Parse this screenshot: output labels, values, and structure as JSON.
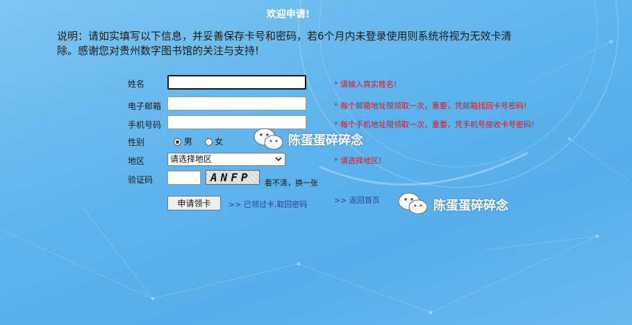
{
  "page": {
    "title": "欢迎申请!",
    "intro": "说明：请如实填写以下信息，并妥善保存卡号和密码，若6个月内未登录使用则系统将视为无效卡清除。感谢您对贵州数字图书馆的关注与支持!"
  },
  "form": {
    "name": {
      "label": "姓名",
      "value": "",
      "hint": "* 请输入真实姓名!"
    },
    "email": {
      "label": "电子邮箱",
      "value": "",
      "hint": "* 每个邮箱地址限领取一次，重要，凭邮箱找回卡号密码!"
    },
    "phone": {
      "label": "手机号码",
      "value": "",
      "hint": "* 每个手机地址限领取一次，重要，凭手机号接收卡号密码!"
    },
    "gender": {
      "label": "性别",
      "options": [
        "男",
        "女"
      ],
      "selected": "男"
    },
    "region": {
      "label": "地区",
      "selected": "请选择地区",
      "hint": "* 请选择地区!"
    },
    "captcha": {
      "label": "验证码",
      "value": "",
      "image_text": "ANFP",
      "refresh_text": "看不清，换一张"
    },
    "submit_label": "申请领卡",
    "retrieve_link": ">> 已领过卡,取回密码",
    "home_link": ">> 返回首页"
  },
  "watermark": {
    "text": "陈蛋蛋碎碎念"
  },
  "colors": {
    "hint": "#e0141e",
    "link": "#2a3f9a",
    "title": "#ffffff"
  }
}
